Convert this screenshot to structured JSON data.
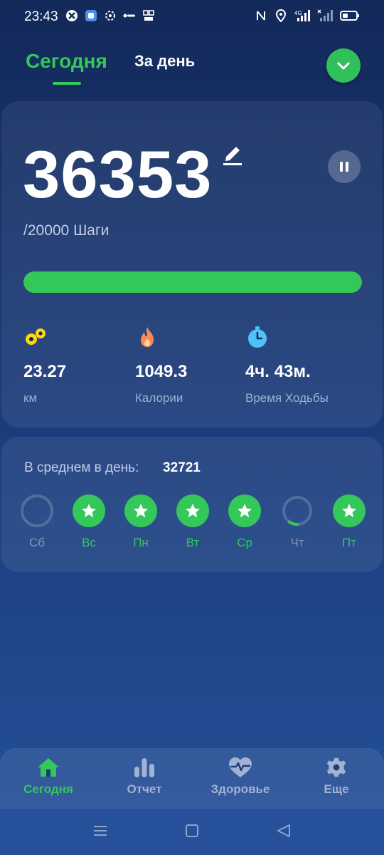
{
  "status_bar": {
    "time": "23:43",
    "left_icons": [
      "app-icon-1",
      "app-icon-2",
      "app-icon-3",
      "app-icon-4",
      "app-icon-5"
    ],
    "right_icons": [
      "nfc-icon",
      "location-icon",
      "signal-4g-icon",
      "signal-x-icon",
      "battery-icon"
    ],
    "network": "4G"
  },
  "header": {
    "tab_today": "Сегодня",
    "tab_day": "За день",
    "dropdown_icon": "chevron-down-icon"
  },
  "steps": {
    "count": "36353",
    "goal_label": "/20000 Шаги",
    "progress": 1.0
  },
  "stats": [
    {
      "icon": "distance-icon",
      "value": "23.27",
      "label": "км",
      "color": "#ffd60a"
    },
    {
      "icon": "flame-icon",
      "value": "1049.3",
      "label": "Калории",
      "color": "#ff8a50"
    },
    {
      "icon": "stopwatch-icon",
      "value": "4ч. 43м.",
      "label": "Время Ходьбы",
      "color": "#4fc3f7"
    }
  ],
  "average": {
    "label": "В среднем в день:",
    "value": "32721"
  },
  "week": [
    {
      "label": "Сб",
      "status": "empty"
    },
    {
      "label": "Вс",
      "status": "done"
    },
    {
      "label": "Пн",
      "status": "done"
    },
    {
      "label": "Вт",
      "status": "done"
    },
    {
      "label": "Ср",
      "status": "done"
    },
    {
      "label": "Чт",
      "status": "partial",
      "progress": 0.1
    },
    {
      "label": "Пт",
      "status": "done"
    }
  ],
  "bottom_nav": [
    {
      "label": "Сегодня",
      "icon": "home-icon",
      "active": true
    },
    {
      "label": "Отчет",
      "icon": "bar-chart-icon",
      "active": false
    },
    {
      "label": "Здоровье",
      "icon": "heart-pulse-icon",
      "active": false
    },
    {
      "label": "Еще",
      "icon": "gear-icon",
      "active": false
    }
  ],
  "colors": {
    "accent": "#34c759",
    "bg_top": "#13295a",
    "bg_bottom": "#24519a"
  }
}
